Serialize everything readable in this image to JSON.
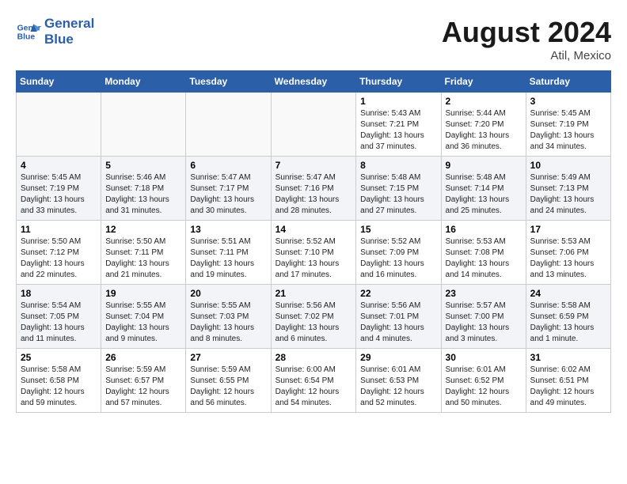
{
  "header": {
    "logo_line1": "General",
    "logo_line2": "Blue",
    "month_title": "August 2024",
    "location": "Atil, Mexico"
  },
  "days_of_week": [
    "Sunday",
    "Monday",
    "Tuesday",
    "Wednesday",
    "Thursday",
    "Friday",
    "Saturday"
  ],
  "weeks": [
    [
      {
        "day": "",
        "sunrise": "",
        "sunset": "",
        "daylight": ""
      },
      {
        "day": "",
        "sunrise": "",
        "sunset": "",
        "daylight": ""
      },
      {
        "day": "",
        "sunrise": "",
        "sunset": "",
        "daylight": ""
      },
      {
        "day": "",
        "sunrise": "",
        "sunset": "",
        "daylight": ""
      },
      {
        "day": "1",
        "sunrise": "5:43 AM",
        "sunset": "7:21 PM",
        "daylight": "13 hours and 37 minutes."
      },
      {
        "day": "2",
        "sunrise": "5:44 AM",
        "sunset": "7:20 PM",
        "daylight": "13 hours and 36 minutes."
      },
      {
        "day": "3",
        "sunrise": "5:45 AM",
        "sunset": "7:19 PM",
        "daylight": "13 hours and 34 minutes."
      }
    ],
    [
      {
        "day": "4",
        "sunrise": "5:45 AM",
        "sunset": "7:19 PM",
        "daylight": "13 hours and 33 minutes."
      },
      {
        "day": "5",
        "sunrise": "5:46 AM",
        "sunset": "7:18 PM",
        "daylight": "13 hours and 31 minutes."
      },
      {
        "day": "6",
        "sunrise": "5:47 AM",
        "sunset": "7:17 PM",
        "daylight": "13 hours and 30 minutes."
      },
      {
        "day": "7",
        "sunrise": "5:47 AM",
        "sunset": "7:16 PM",
        "daylight": "13 hours and 28 minutes."
      },
      {
        "day": "8",
        "sunrise": "5:48 AM",
        "sunset": "7:15 PM",
        "daylight": "13 hours and 27 minutes."
      },
      {
        "day": "9",
        "sunrise": "5:48 AM",
        "sunset": "7:14 PM",
        "daylight": "13 hours and 25 minutes."
      },
      {
        "day": "10",
        "sunrise": "5:49 AM",
        "sunset": "7:13 PM",
        "daylight": "13 hours and 24 minutes."
      }
    ],
    [
      {
        "day": "11",
        "sunrise": "5:50 AM",
        "sunset": "7:12 PM",
        "daylight": "13 hours and 22 minutes."
      },
      {
        "day": "12",
        "sunrise": "5:50 AM",
        "sunset": "7:11 PM",
        "daylight": "13 hours and 21 minutes."
      },
      {
        "day": "13",
        "sunrise": "5:51 AM",
        "sunset": "7:11 PM",
        "daylight": "13 hours and 19 minutes."
      },
      {
        "day": "14",
        "sunrise": "5:52 AM",
        "sunset": "7:10 PM",
        "daylight": "13 hours and 17 minutes."
      },
      {
        "day": "15",
        "sunrise": "5:52 AM",
        "sunset": "7:09 PM",
        "daylight": "13 hours and 16 minutes."
      },
      {
        "day": "16",
        "sunrise": "5:53 AM",
        "sunset": "7:08 PM",
        "daylight": "13 hours and 14 minutes."
      },
      {
        "day": "17",
        "sunrise": "5:53 AM",
        "sunset": "7:06 PM",
        "daylight": "13 hours and 13 minutes."
      }
    ],
    [
      {
        "day": "18",
        "sunrise": "5:54 AM",
        "sunset": "7:05 PM",
        "daylight": "13 hours and 11 minutes."
      },
      {
        "day": "19",
        "sunrise": "5:55 AM",
        "sunset": "7:04 PM",
        "daylight": "13 hours and 9 minutes."
      },
      {
        "day": "20",
        "sunrise": "5:55 AM",
        "sunset": "7:03 PM",
        "daylight": "13 hours and 8 minutes."
      },
      {
        "day": "21",
        "sunrise": "5:56 AM",
        "sunset": "7:02 PM",
        "daylight": "13 hours and 6 minutes."
      },
      {
        "day": "22",
        "sunrise": "5:56 AM",
        "sunset": "7:01 PM",
        "daylight": "13 hours and 4 minutes."
      },
      {
        "day": "23",
        "sunrise": "5:57 AM",
        "sunset": "7:00 PM",
        "daylight": "13 hours and 3 minutes."
      },
      {
        "day": "24",
        "sunrise": "5:58 AM",
        "sunset": "6:59 PM",
        "daylight": "13 hours and 1 minute."
      }
    ],
    [
      {
        "day": "25",
        "sunrise": "5:58 AM",
        "sunset": "6:58 PM",
        "daylight": "12 hours and 59 minutes."
      },
      {
        "day": "26",
        "sunrise": "5:59 AM",
        "sunset": "6:57 PM",
        "daylight": "12 hours and 57 minutes."
      },
      {
        "day": "27",
        "sunrise": "5:59 AM",
        "sunset": "6:55 PM",
        "daylight": "12 hours and 56 minutes."
      },
      {
        "day": "28",
        "sunrise": "6:00 AM",
        "sunset": "6:54 PM",
        "daylight": "12 hours and 54 minutes."
      },
      {
        "day": "29",
        "sunrise": "6:01 AM",
        "sunset": "6:53 PM",
        "daylight": "12 hours and 52 minutes."
      },
      {
        "day": "30",
        "sunrise": "6:01 AM",
        "sunset": "6:52 PM",
        "daylight": "12 hours and 50 minutes."
      },
      {
        "day": "31",
        "sunrise": "6:02 AM",
        "sunset": "6:51 PM",
        "daylight": "12 hours and 49 minutes."
      }
    ]
  ]
}
